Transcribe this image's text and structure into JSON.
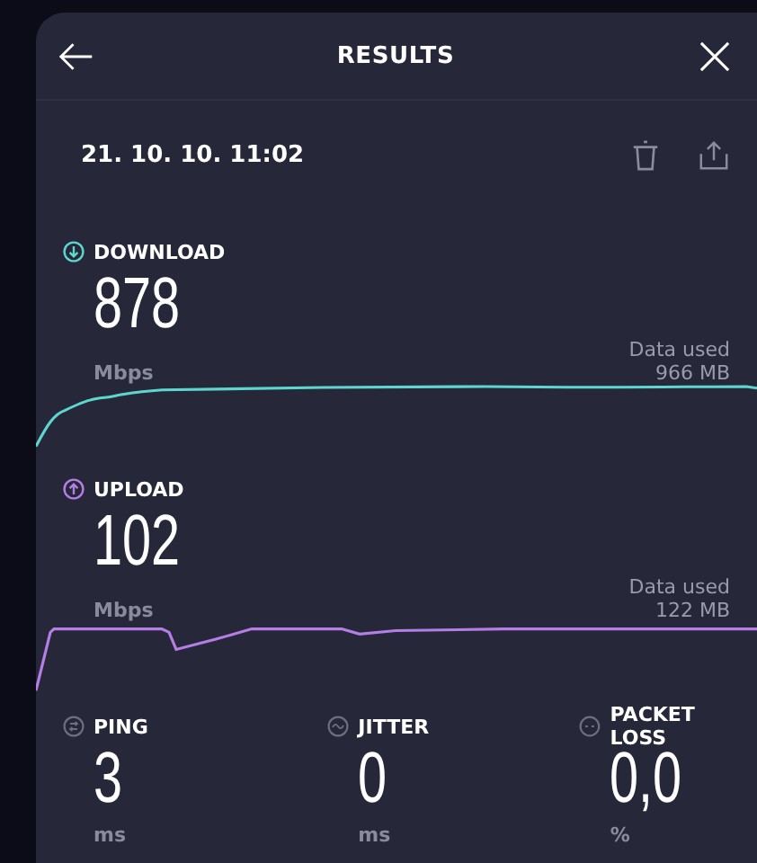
{
  "header": {
    "title": "RESULTS"
  },
  "date": "21. 10. 10. 11:02",
  "speeds": [
    {
      "kind": "download",
      "label": "DOWNLOAD",
      "value": "878",
      "unit": "Mbps",
      "data_used_label": "Data used",
      "data_used_value": "966 MB",
      "color": "#5ed6d0"
    },
    {
      "kind": "upload",
      "label": "UPLOAD",
      "value": "102",
      "unit": "Mbps",
      "data_used_label": "Data used",
      "data_used_value": "122 MB",
      "color": "#b57ee6"
    }
  ],
  "stats": [
    {
      "kind": "ping",
      "label": "PING",
      "value": "3",
      "unit": "ms"
    },
    {
      "kind": "jitter",
      "label": "JITTER",
      "value": "0",
      "unit": "ms"
    },
    {
      "kind": "packet_loss",
      "label": "PACKET LOSS",
      "value": "0,0",
      "unit": "%"
    }
  ]
}
